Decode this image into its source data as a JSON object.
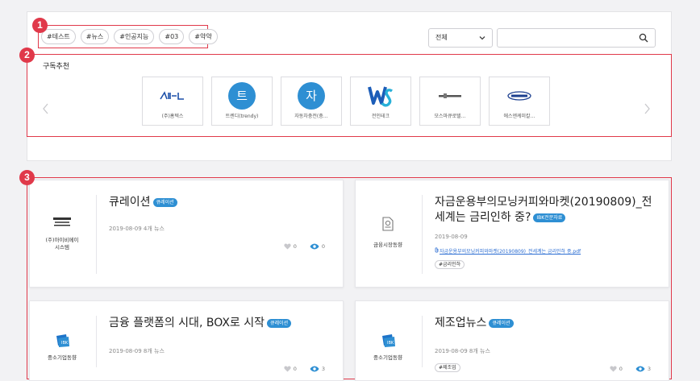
{
  "tags": [
    "#테스트",
    "#뉴스",
    "#인공지능",
    "#03",
    "#약약"
  ],
  "filter": {
    "selected": "전체"
  },
  "search": {
    "placeholder": ""
  },
  "subscribe": {
    "title": "구독추천",
    "items": [
      {
        "name": "(주)홈텍스",
        "logo": "ahnlab-wordmark"
      },
      {
        "name": "트렌디(trendy)",
        "logo": "circle-letter",
        "letter": "트"
      },
      {
        "name": "자동차충전(충…",
        "logo": "circle-letter",
        "letter": "자"
      },
      {
        "name": "전인테크",
        "logo": "ws-logo"
      },
      {
        "name": "모스마큐로텔…",
        "logo": "small-wordmark"
      },
      {
        "name": "에스엔케미칼…",
        "logo": "oval-logo"
      }
    ]
  },
  "markers": [
    "1",
    "2",
    "3"
  ],
  "cards": [
    {
      "brand": "(주)아이비메이 시스템",
      "title": "큐레이션",
      "badge": "큐레이션",
      "meta": "2019-08-09 4개 뉴스",
      "likes": "0",
      "views": "0"
    },
    {
      "brand": "금융시장동향",
      "title": "자금운용부의모닝커피와마켓(20190809)_전세계는 금리인하 중?",
      "badge": "IBK전문자료",
      "meta": "2019-08-09",
      "link": "자금운용부의모닝커피와마켓(20190809)_전세계는 금리인하 중.pdf",
      "hashtag": "#금리인하"
    },
    {
      "brand": "중소기업동향",
      "title": "금융 플랫폼의 시대, BOX로 시작",
      "badge": "큐레이션",
      "meta": "2019-08-09 8개 뉴스",
      "likes": "0",
      "views": "3"
    },
    {
      "brand": "중소기업동향",
      "title": "제조업뉴스",
      "badge": "큐레이션",
      "meta": "2019-08-09 8개 뉴스",
      "hashtag": "#제조업",
      "likes": "0",
      "views": "3"
    }
  ],
  "colors": {
    "accent": "#2e8fd3",
    "marker": "#e0394a"
  }
}
